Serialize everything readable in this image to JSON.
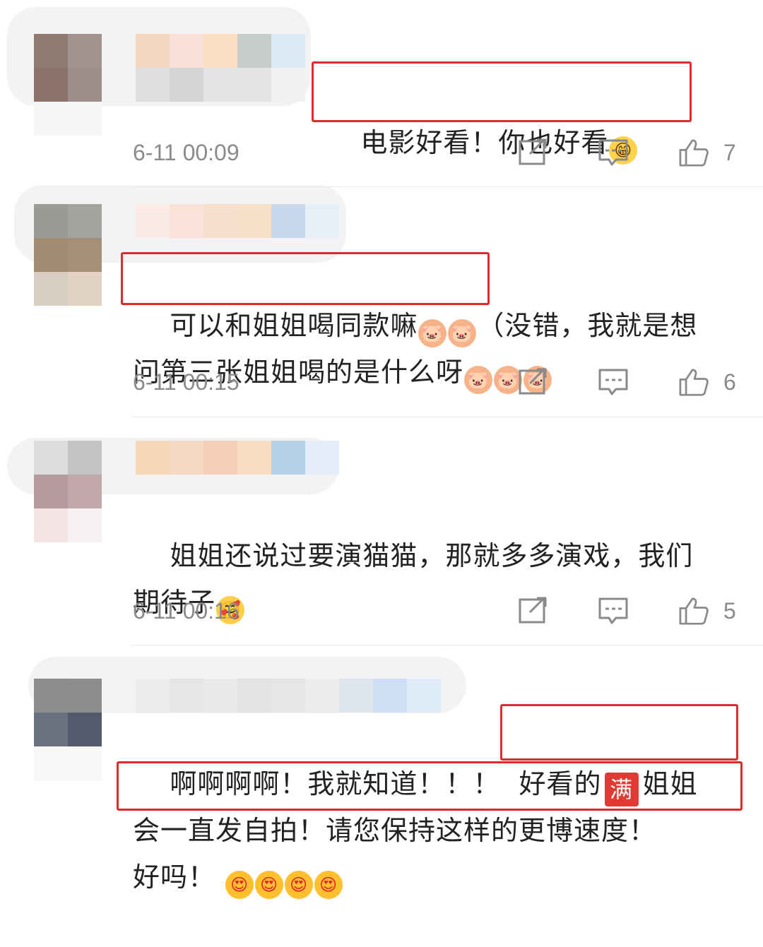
{
  "comments": [
    {
      "text": "电影好看！你也好看",
      "emojis": [
        "grin-emoji"
      ],
      "time": "6-11 00:09",
      "likes": "7"
    },
    {
      "text_line1": "可以和姐姐喝同款嘛",
      "text_line1b": "（没错，我就是想",
      "text_line2": "问第三张姐姐喝的是什么呀",
      "time": "6-11 00:15",
      "likes": "6"
    },
    {
      "text_line1": "姐姐还说过要演猫猫，那就多多演戏，我们",
      "text_line2": "期待子",
      "time": "6-11 00:16",
      "likes": "5"
    },
    {
      "text_line1a": "啊啊啊啊！我就知道！！！",
      "text_line1b": "好看的",
      "badge": "满",
      "text_line1c": "姐姐",
      "text_line2": "会一直发自拍！请您保持这样的更博速度！",
      "text_line3": "好吗！"
    }
  ],
  "colors": {
    "highlight": "#e02b2b",
    "text": "#222222",
    "meta": "#8a8a8a"
  }
}
